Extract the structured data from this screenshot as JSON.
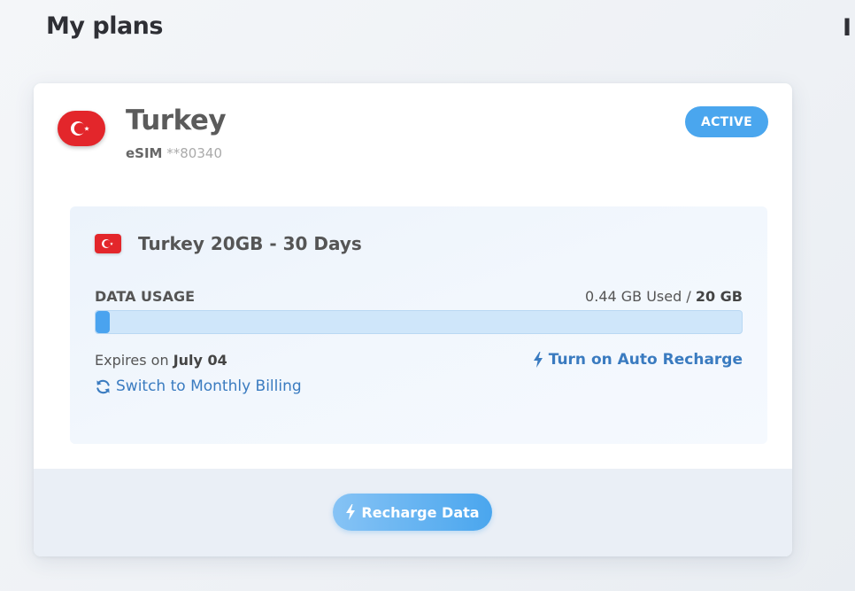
{
  "page": {
    "title": "My plans",
    "edge_fragment": "I"
  },
  "plan_card": {
    "country": "Turkey",
    "esim_label": "eSIM",
    "esim_number": "**80340",
    "status": "ACTIVE",
    "flag_icon": "turkey-flag-icon",
    "plan": {
      "name": "Turkey 20GB - 30 Days",
      "data_usage_label": "DATA USAGE",
      "used": "0.44 GB Used",
      "separator": " / ",
      "total": "20 GB",
      "used_fraction": 0.022,
      "expires_prefix": "Expires on ",
      "expires_date": "July 04",
      "auto_recharge_label": "Turn on Auto Recharge",
      "monthly_billing_label": "Switch to Monthly Billing"
    },
    "recharge_button_label": "Recharge Data"
  },
  "icons": {
    "lightning": "lightning-icon",
    "refresh": "refresh-icon"
  },
  "colors": {
    "accent": "#4aa6ee",
    "link": "#3a7bc0",
    "flag_red": "#e3262b"
  }
}
